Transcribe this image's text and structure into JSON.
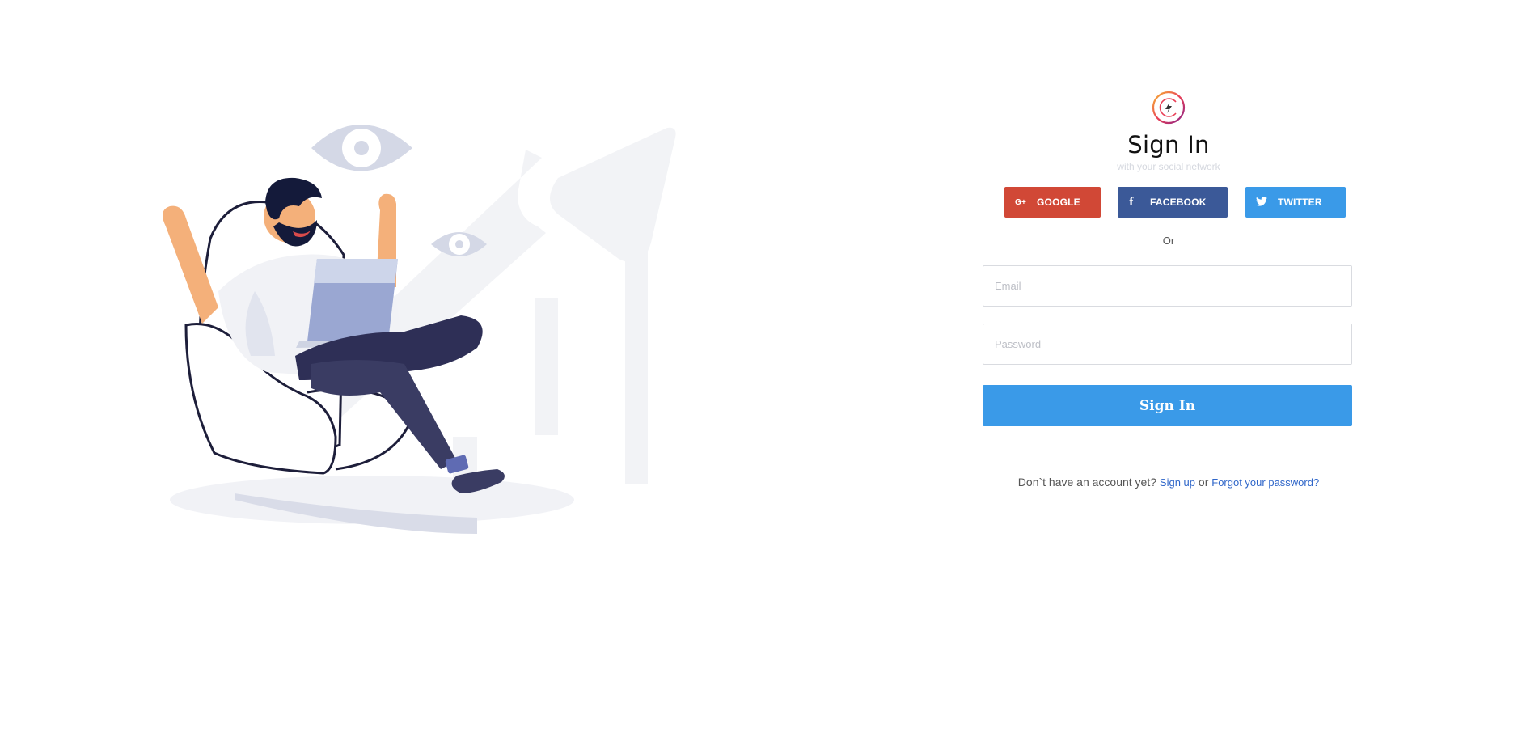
{
  "auth": {
    "title": "Sign In",
    "subtitle": "with your social network",
    "social": {
      "google": {
        "label": "GOOGLE",
        "icon": "google-plus-icon",
        "icon_text": "G+",
        "color": "#d14836"
      },
      "facebook": {
        "label": "FACEBOOK",
        "icon": "facebook-icon",
        "icon_text": "f",
        "color": "#3b5998"
      },
      "twitter": {
        "label": "TWITTER",
        "icon": "twitter-icon",
        "color": "#3a9ae8"
      }
    },
    "or_label": "Or",
    "email_placeholder": "Email",
    "password_placeholder": "Password",
    "submit_label": "Sign In",
    "footer": {
      "prompt": "Don`t have an account yet?",
      "signup_label": "Sign up",
      "connector": "or",
      "forgot_label": "Forgot your password?"
    }
  },
  "colors": {
    "accent": "#3a9ae8",
    "link": "#2f66c9"
  }
}
